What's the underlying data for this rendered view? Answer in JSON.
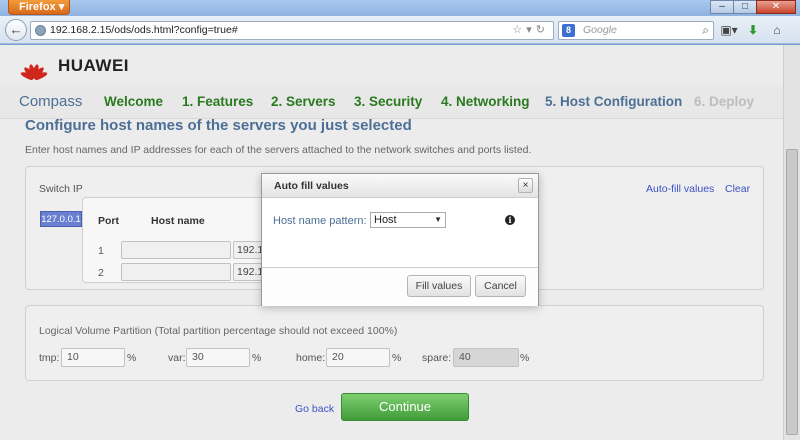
{
  "browser": {
    "app_button": "Firefox",
    "url": "192.168.2.15/ods/ods.html?config=true#",
    "search_placeholder": "Google",
    "search_engine_glyph": "8"
  },
  "brand": {
    "name": "HUAWEI",
    "logo_color": "#d0261c"
  },
  "steps": [
    {
      "label": "Compass"
    },
    {
      "label": "Welcome"
    },
    {
      "label": "1. Features"
    },
    {
      "label": "2. Servers"
    },
    {
      "label": "3. Security"
    },
    {
      "label": "4. Networking"
    },
    {
      "label": "5. Host Configuration"
    },
    {
      "label": "6. Deploy"
    }
  ],
  "main": {
    "title": "Configure host names of the servers you just selected",
    "description": "Enter host names and IP addresses for each of the servers attached to the network switches and ports listed.",
    "switch_ip_label": "Switch IP",
    "switch_ip": "127.0.0.1",
    "table": {
      "col_port": "Port",
      "col_host": "Host name",
      "rows": [
        {
          "port": "1",
          "host": "",
          "ip": "192.1"
        },
        {
          "port": "2",
          "host": "",
          "ip": "192.1"
        }
      ]
    },
    "autofill_link": "Auto-fill values",
    "clear_link": "Clear"
  },
  "partition": {
    "title": "Logical Volume Partition (Total partition percentage should not exceed 100%)",
    "fields": [
      {
        "label": "tmp:",
        "value": "10",
        "unit": "%"
      },
      {
        "label": "var:",
        "value": "30",
        "unit": "%"
      },
      {
        "label": "home:",
        "value": "20",
        "unit": "%"
      },
      {
        "label": "spare:",
        "value": "40",
        "unit": "%"
      }
    ]
  },
  "footer": {
    "go_back": "Go back",
    "continue": "Continue"
  },
  "modal": {
    "title": "Auto fill values",
    "close": "×",
    "pattern_label": "Host name pattern:",
    "pattern_value": "Host",
    "info": "i",
    "fill_button": "Fill values",
    "cancel_button": "Cancel"
  }
}
